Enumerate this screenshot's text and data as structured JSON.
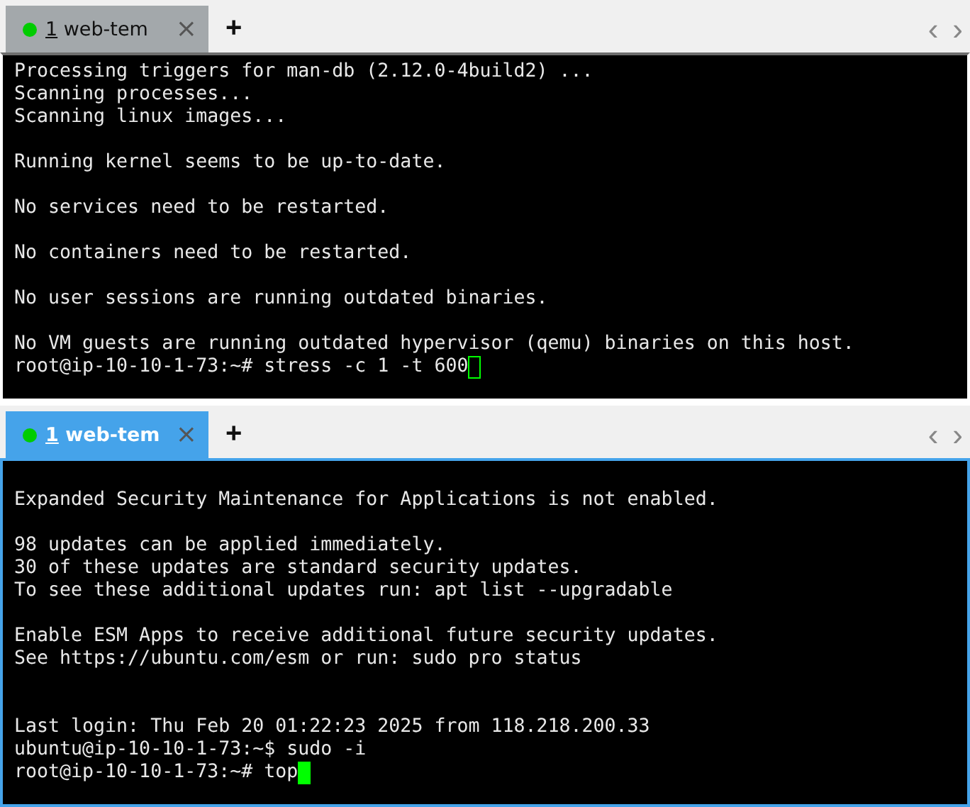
{
  "panes": [
    {
      "selected": false,
      "tab": {
        "hotkey": "1",
        "label": "web-tem",
        "close": "×",
        "color": "#00cc00"
      },
      "new_tab": "+",
      "nav": [
        "‹",
        "›"
      ],
      "lines": [
        {
          "kind": "text",
          "text": "Processing triggers for man-db (2.12.0-4build2) ..."
        },
        {
          "kind": "text",
          "text": "Scanning processes..."
        },
        {
          "kind": "text",
          "text": "Scanning linux images..."
        },
        {
          "kind": "blank"
        },
        {
          "kind": "text",
          "text": "Running kernel seems to be up-to-date."
        },
        {
          "kind": "blank"
        },
        {
          "kind": "text",
          "text": "No services need to be restarted."
        },
        {
          "kind": "blank"
        },
        {
          "kind": "text",
          "text": "No containers need to be restarted."
        },
        {
          "kind": "blank"
        },
        {
          "kind": "text",
          "text": "No user sessions are running outdated binaries."
        },
        {
          "kind": "blank"
        },
        {
          "kind": "text",
          "text": "No VM guests are running outdated hypervisor (qemu) binaries on this host."
        },
        {
          "kind": "prompt",
          "text": "root@ip-10-10-1-73:~# stress -c 1 -t 600"
        }
      ]
    },
    {
      "selected": true,
      "tab": {
        "hotkey": "1",
        "label": "web-tem",
        "close": "×",
        "color": "#00cc00"
      },
      "new_tab": "+",
      "nav": [
        "‹",
        "›"
      ],
      "lines": [
        {
          "kind": "blank"
        },
        {
          "kind": "text",
          "text": "Expanded Security Maintenance for Applications is not enabled."
        },
        {
          "kind": "blank"
        },
        {
          "kind": "text",
          "text": "98 updates can be applied immediately."
        },
        {
          "kind": "text",
          "text": "30 of these updates are standard security updates."
        },
        {
          "kind": "text",
          "text": "To see these additional updates run: apt list --upgradable"
        },
        {
          "kind": "blank"
        },
        {
          "kind": "text",
          "text": "Enable ESM Apps to receive additional future security updates."
        },
        {
          "kind": "text",
          "text": "See https://ubuntu.com/esm or run: sudo pro status"
        },
        {
          "kind": "blank"
        },
        {
          "kind": "blank"
        },
        {
          "kind": "text",
          "text": "Last login: Thu Feb 20 01:22:23 2025 from 118.218.200.33"
        },
        {
          "kind": "text",
          "text": "ubuntu@ip-10-10-1-73:~$ sudo -i"
        },
        {
          "kind": "prompt",
          "text": "root@ip-10-10-1-73:~# top"
        }
      ]
    }
  ]
}
